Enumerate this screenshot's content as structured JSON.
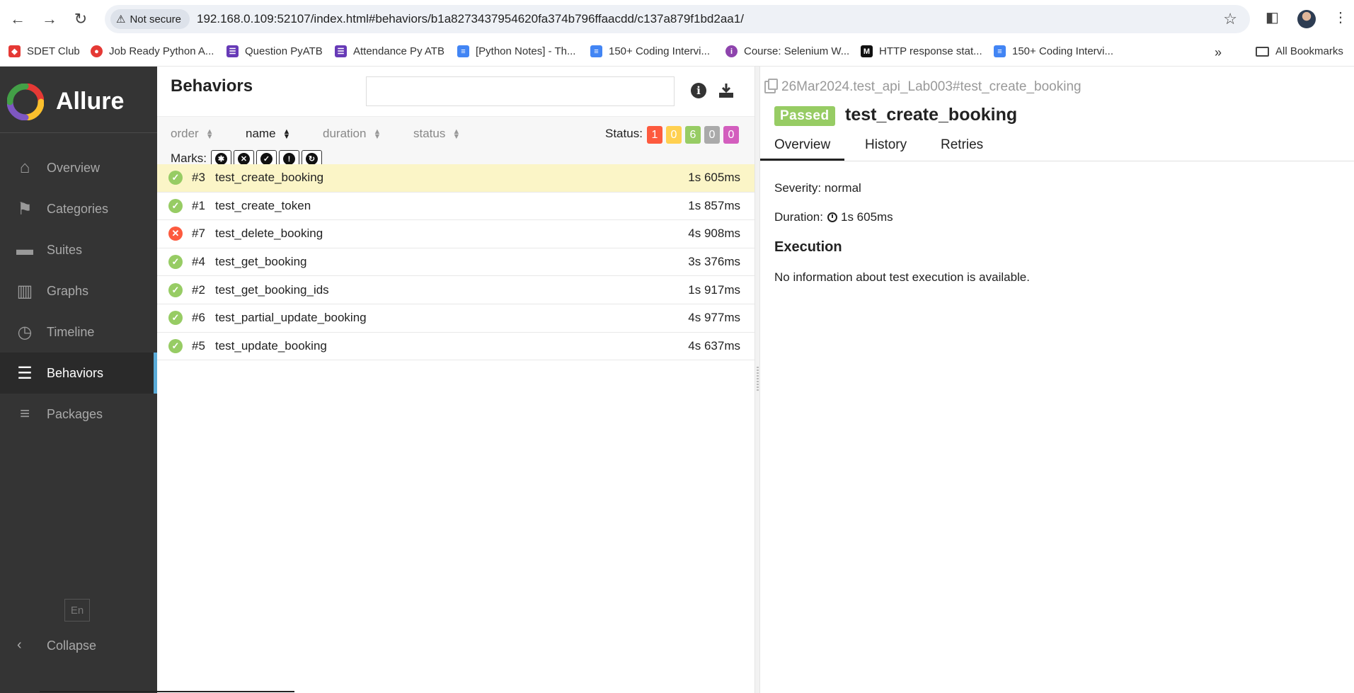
{
  "browser": {
    "security_label": "Not secure",
    "url": "192.168.0.109:52107/index.html#behaviors/b1a8273437954620fa374b796ffaacdd/c137a879f1bd2aa1/",
    "bookmarks": [
      {
        "label": "SDET Club",
        "color": "#e53935"
      },
      {
        "label": "Job Ready Python A...",
        "color": "#e53935"
      },
      {
        "label": "Question PyATB",
        "color": "#673ab7"
      },
      {
        "label": "Attendance Py ATB",
        "color": "#673ab7"
      },
      {
        "label": "[Python Notes] - Th...",
        "color": "#4285f4"
      },
      {
        "label": "150+ Coding Intervi...",
        "color": "#4285f4"
      },
      {
        "label": "Course: Selenium W...",
        "color": "#8e44ad"
      },
      {
        "label": "HTTP response stat...",
        "color": "#111111"
      },
      {
        "label": "150+ Coding Intervi...",
        "color": "#4285f4"
      }
    ],
    "all_bookmarks_label": "All Bookmarks"
  },
  "sidebar": {
    "brand": "Allure",
    "items": [
      {
        "label": "Overview",
        "icon": "home-icon"
      },
      {
        "label": "Categories",
        "icon": "flag-icon"
      },
      {
        "label": "Suites",
        "icon": "briefcase-icon"
      },
      {
        "label": "Graphs",
        "icon": "bar-chart-icon"
      },
      {
        "label": "Timeline",
        "icon": "clock-icon"
      },
      {
        "label": "Behaviors",
        "icon": "list-icon",
        "active": true
      },
      {
        "label": "Packages",
        "icon": "align-left-icon"
      }
    ],
    "language": "En",
    "collapse_label": "Collapse"
  },
  "behaviors": {
    "title": "Behaviors",
    "sort": {
      "order": "order",
      "name": "name",
      "duration": "duration",
      "status": "status"
    },
    "status_label": "Status:",
    "status_counts": [
      {
        "value": "1",
        "color": "#fd5a3e"
      },
      {
        "value": "0",
        "color": "#ffd050"
      },
      {
        "value": "6",
        "color": "#97cc64"
      },
      {
        "value": "0",
        "color": "#aaaaaa"
      },
      {
        "value": "0",
        "color": "#d35ebe"
      }
    ],
    "marks_label": "Marks:",
    "rows": [
      {
        "order": "#3",
        "name": "test_create_booking",
        "duration": "1s 605ms",
        "status": "passed",
        "selected": true
      },
      {
        "order": "#1",
        "name": "test_create_token",
        "duration": "1s 857ms",
        "status": "passed"
      },
      {
        "order": "#7",
        "name": "test_delete_booking",
        "duration": "4s 908ms",
        "status": "failed"
      },
      {
        "order": "#4",
        "name": "test_get_booking",
        "duration": "3s 376ms",
        "status": "passed"
      },
      {
        "order": "#2",
        "name": "test_get_booking_ids",
        "duration": "1s 917ms",
        "status": "passed"
      },
      {
        "order": "#6",
        "name": "test_partial_update_booking",
        "duration": "4s 977ms",
        "status": "passed"
      },
      {
        "order": "#5",
        "name": "test_update_booking",
        "duration": "4s 637ms",
        "status": "passed"
      }
    ]
  },
  "detail": {
    "breadcrumb": "26Mar2024.test_api_Lab003#test_create_booking",
    "status_badge": "Passed",
    "title": "test_create_booking",
    "tabs": [
      "Overview",
      "History",
      "Retries"
    ],
    "severity": "Severity: normal",
    "duration_label": "Duration:",
    "duration_value": "1s 605ms",
    "execution_title": "Execution",
    "execution_text": "No information about test execution is available."
  },
  "colors": {
    "passed": "#97cc64",
    "failed": "#fd5a3e",
    "accent": "#5aabd8"
  }
}
